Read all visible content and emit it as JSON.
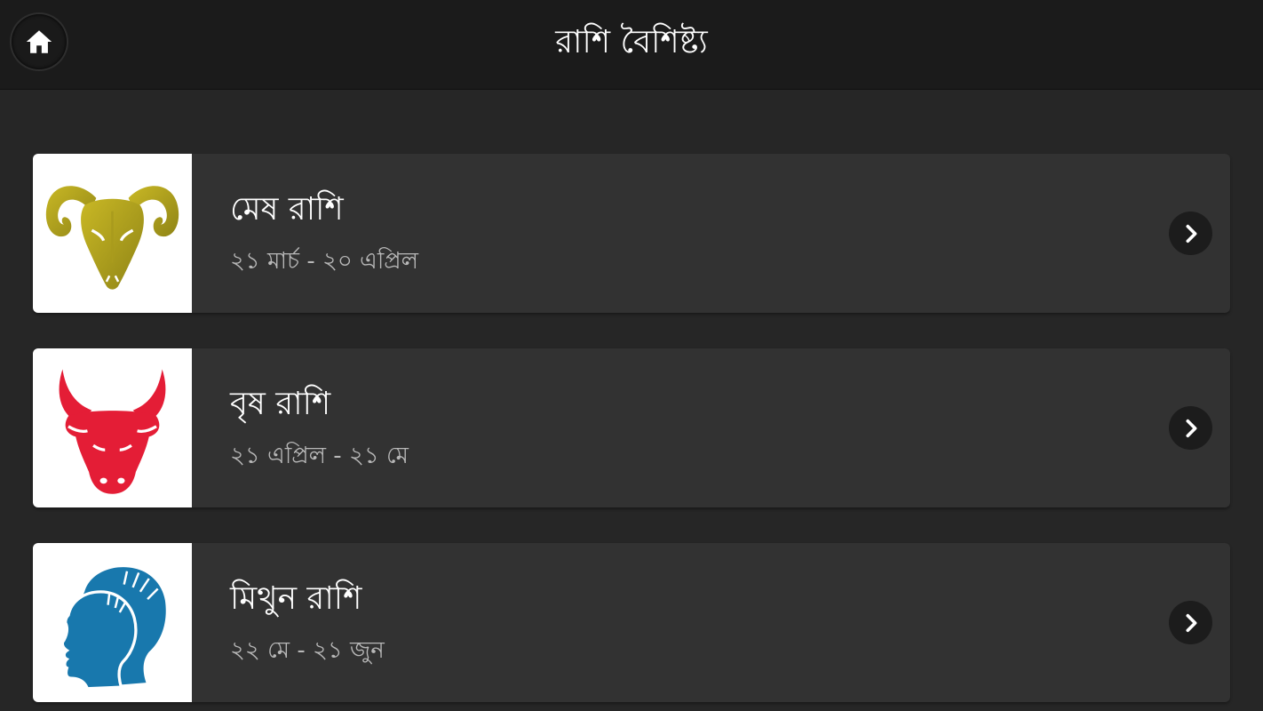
{
  "header": {
    "title": "রাশি বৈশিষ্ট্য",
    "home_icon": "home-icon"
  },
  "colors": {
    "header_bg": "#1b1b1b",
    "page_bg": "#262626",
    "card_bg": "#323232",
    "aries": "#b5a51f",
    "taurus": "#e41d36",
    "gemini": "#1878ad"
  },
  "signs": [
    {
      "name": "মেষ রাশি",
      "dates": "২১ মার্চ - ২০ এপ্রিল",
      "icon": "ram-icon"
    },
    {
      "name": "বৃষ রাশি",
      "dates": "২১ এপ্রিল - ২১ মে",
      "icon": "bull-icon"
    },
    {
      "name": "মিথুন রাশি",
      "dates": "২২ মে - ২১ জুন",
      "icon": "twins-icon"
    }
  ]
}
